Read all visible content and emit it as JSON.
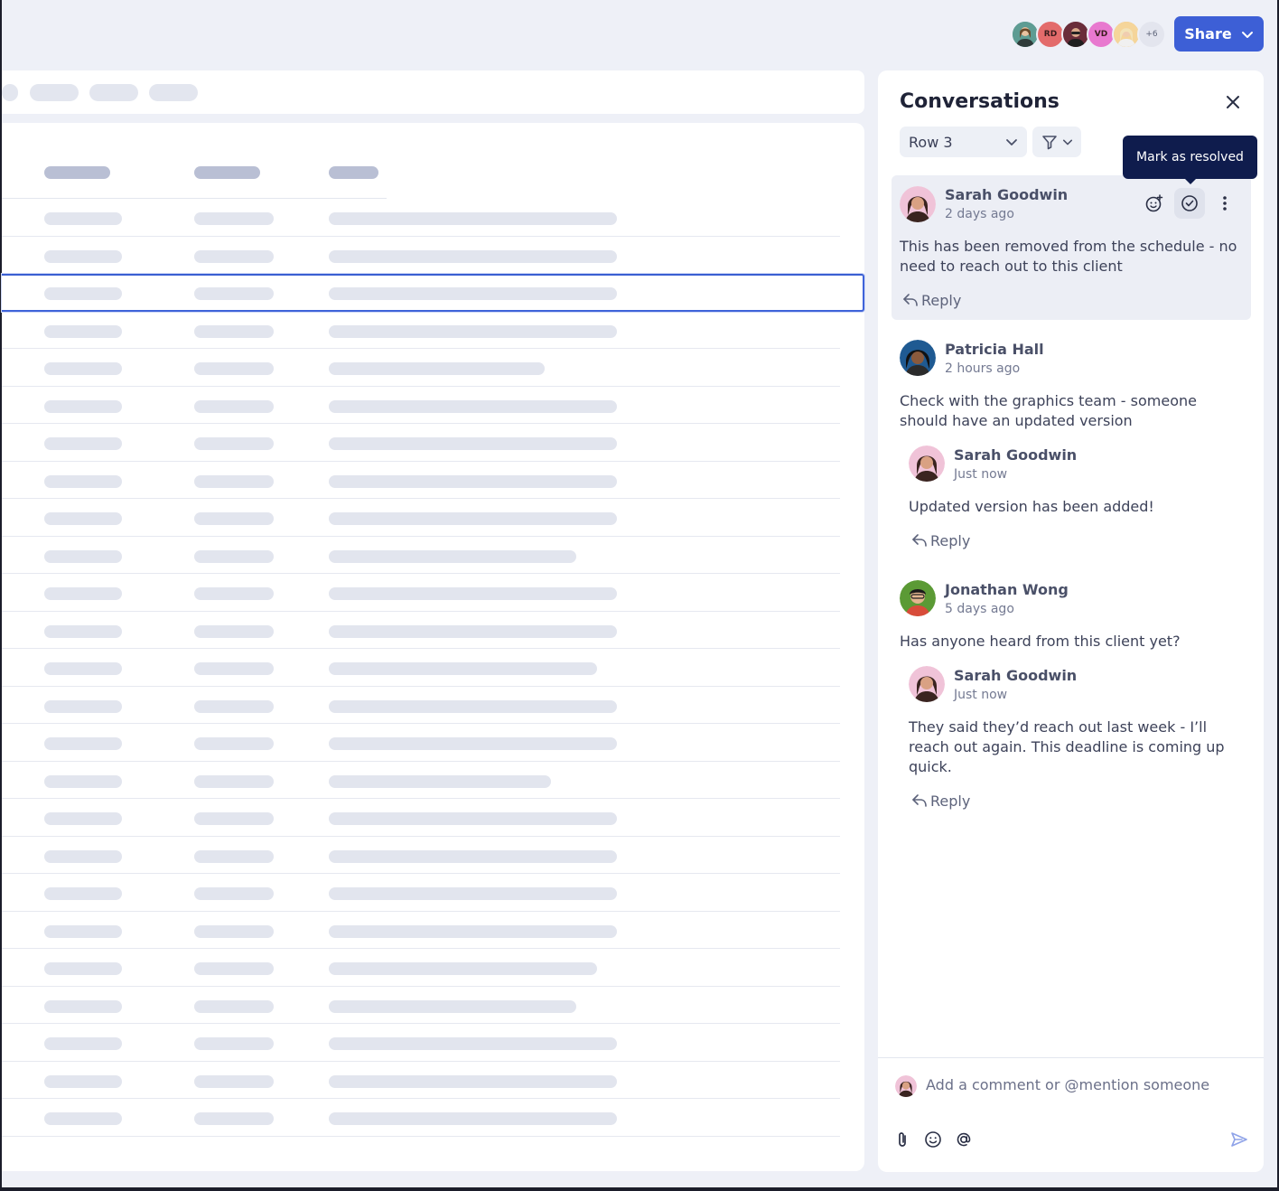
{
  "topbar": {
    "avatars": [
      {
        "kind": "photo",
        "color": "#4f8f8a"
      },
      {
        "kind": "initials",
        "initials": "RD",
        "color": "#e36b6b"
      },
      {
        "kind": "photo",
        "color": "#7a3a4a"
      },
      {
        "kind": "initials",
        "initials": "VD",
        "color": "#e879cf"
      },
      {
        "kind": "photo",
        "color": "#f3c27a"
      },
      {
        "kind": "more",
        "initials": "+6",
        "color": "#e3e5ee"
      }
    ],
    "share_label": "Share"
  },
  "sheet": {
    "row_fill_fractions": [
      1,
      1,
      1,
      1,
      0.75,
      1,
      1,
      1,
      1,
      0.86,
      1,
      1,
      0.93,
      1,
      1,
      0.77,
      1,
      1,
      1,
      1,
      0.93,
      0.86,
      1,
      1,
      1
    ],
    "selected_row_index": 2
  },
  "panel": {
    "title": "Conversations",
    "row_filter": "Row 3",
    "tooltip": "Mark as resolved",
    "comments": [
      {
        "name": "Sarah Goodwin",
        "time": "2 days ago",
        "text": "This has been removed from the schedule - no need to reach out to this client",
        "reply": "Reply"
      },
      {
        "name": "Patricia Hall",
        "time": "2 hours ago",
        "text": "Check with the graphics team - someone should have an updated version",
        "reply_thread": {
          "name": "Sarah Goodwin",
          "time": "Just now",
          "text": "Updated version has been added!",
          "reply": "Reply"
        }
      },
      {
        "name": "Jonathan Wong",
        "time": "5 days ago",
        "text": "Has anyone heard from this client yet?",
        "reply_thread": {
          "name": "Sarah Goodwin",
          "time": "Just now",
          "text": "They said they’d reach out last week - I’ll reach out again. This deadline is coming up quick.",
          "reply": "Reply"
        }
      }
    ],
    "composer_placeholder": "Add a comment or @mention someone"
  },
  "colors": {
    "accent": "#3d5fd6",
    "tooltip_bg": "#0f1c4d",
    "highlight_bg": "#eceef5"
  }
}
